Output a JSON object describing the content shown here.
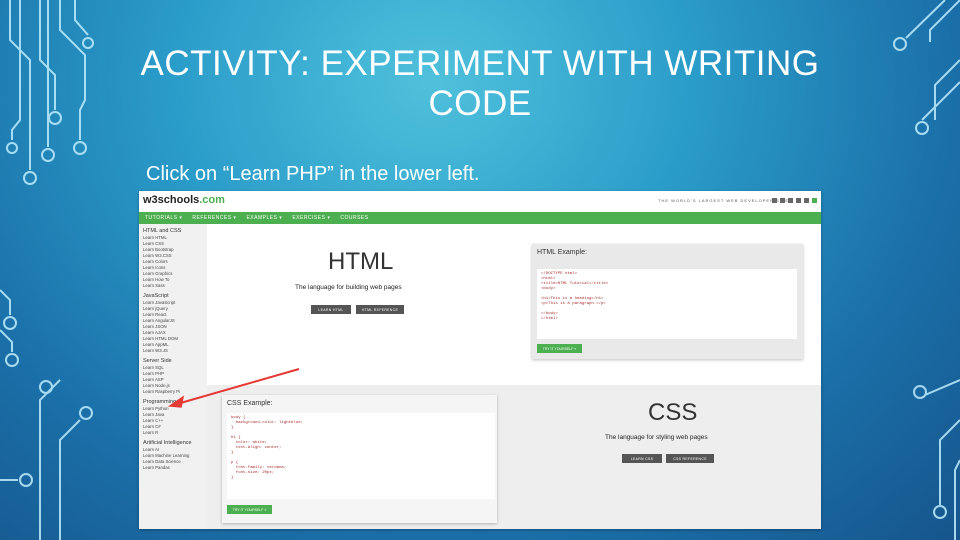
{
  "slide": {
    "title": "ACTIVITY: EXPERIMENT WITH WRITING CODE",
    "instruction": "Click on “Learn PHP” in the lower left."
  },
  "website": {
    "logo": "w3schools",
    "logo_suffix": ".com",
    "tagline": "THE WORLD'S LARGEST WEB DEVELOPER SITE",
    "nav": [
      "TUTORIALS ▾",
      "REFERENCES ▾",
      "EXAMPLES ▾",
      "EXERCISES ▾",
      "COURSES"
    ],
    "sidebar": [
      {
        "heading": "HTML and CSS",
        "items": [
          "Learn HTML",
          "Learn CSS",
          "Learn Bootstrap",
          "Learn W3.CSS",
          "Learn Colors",
          "Learn Icons",
          "Learn Graphics",
          "Learn How To",
          "Learn Sass"
        ]
      },
      {
        "heading": "JavaScript",
        "items": [
          "Learn JavaScript",
          "Learn jQuery",
          "Learn React",
          "Learn AngularJS",
          "Learn JSON",
          "Learn AJAX",
          "Learn HTML DOM",
          "Learn AppML",
          "Learn W3.JS"
        ]
      },
      {
        "heading": "Server Side",
        "items": [
          "Learn SQL",
          "Learn PHP",
          "Learn ASP",
          "Learn Node.js",
          "Learn Raspberry Pi"
        ]
      },
      {
        "heading": "Programming",
        "items": [
          "Learn Python",
          "Learn Java",
          "Learn C++",
          "Learn C#",
          "Learn R"
        ]
      },
      {
        "heading": "Artificial Intelligence",
        "items": [
          "Learn AI",
          "Learn Machine Learning",
          "Learn Data Science",
          "Learn Pandas"
        ]
      }
    ],
    "html_section": {
      "heading": "HTML",
      "description": "The language for building web pages",
      "learn_button": "LEARN HTML",
      "reference_button": "HTML REFERENCE",
      "example_title": "HTML Example:",
      "code": [
        "<!DOCTYPE html>",
        "<html>",
        "<title>HTML Tutorial</title>",
        "<body>",
        "",
        "<h1>This is a heading</h1>",
        "<p>This is a paragraph.</p>",
        "",
        "</body>",
        "</html>"
      ],
      "try_button": "TRY IT YOURSELF »"
    },
    "css_section": {
      "heading": "CSS",
      "description": "The language for styling web pages",
      "learn_button": "LEARN CSS",
      "reference_button": "CSS REFERENCE",
      "example_title": "CSS Example:",
      "code": [
        "body {",
        "  background-color: lightblue;",
        "}",
        "",
        "h1 {",
        "  color: white;",
        "  text-align: center;",
        "}",
        "",
        "p {",
        "  font-family: verdana;",
        "  font-size: 20px;",
        "}"
      ],
      "try_button": "TRY IT YOURSELF »"
    }
  },
  "colors": {
    "w3_green": "#4caf50",
    "arrow_red": "#e53935"
  }
}
